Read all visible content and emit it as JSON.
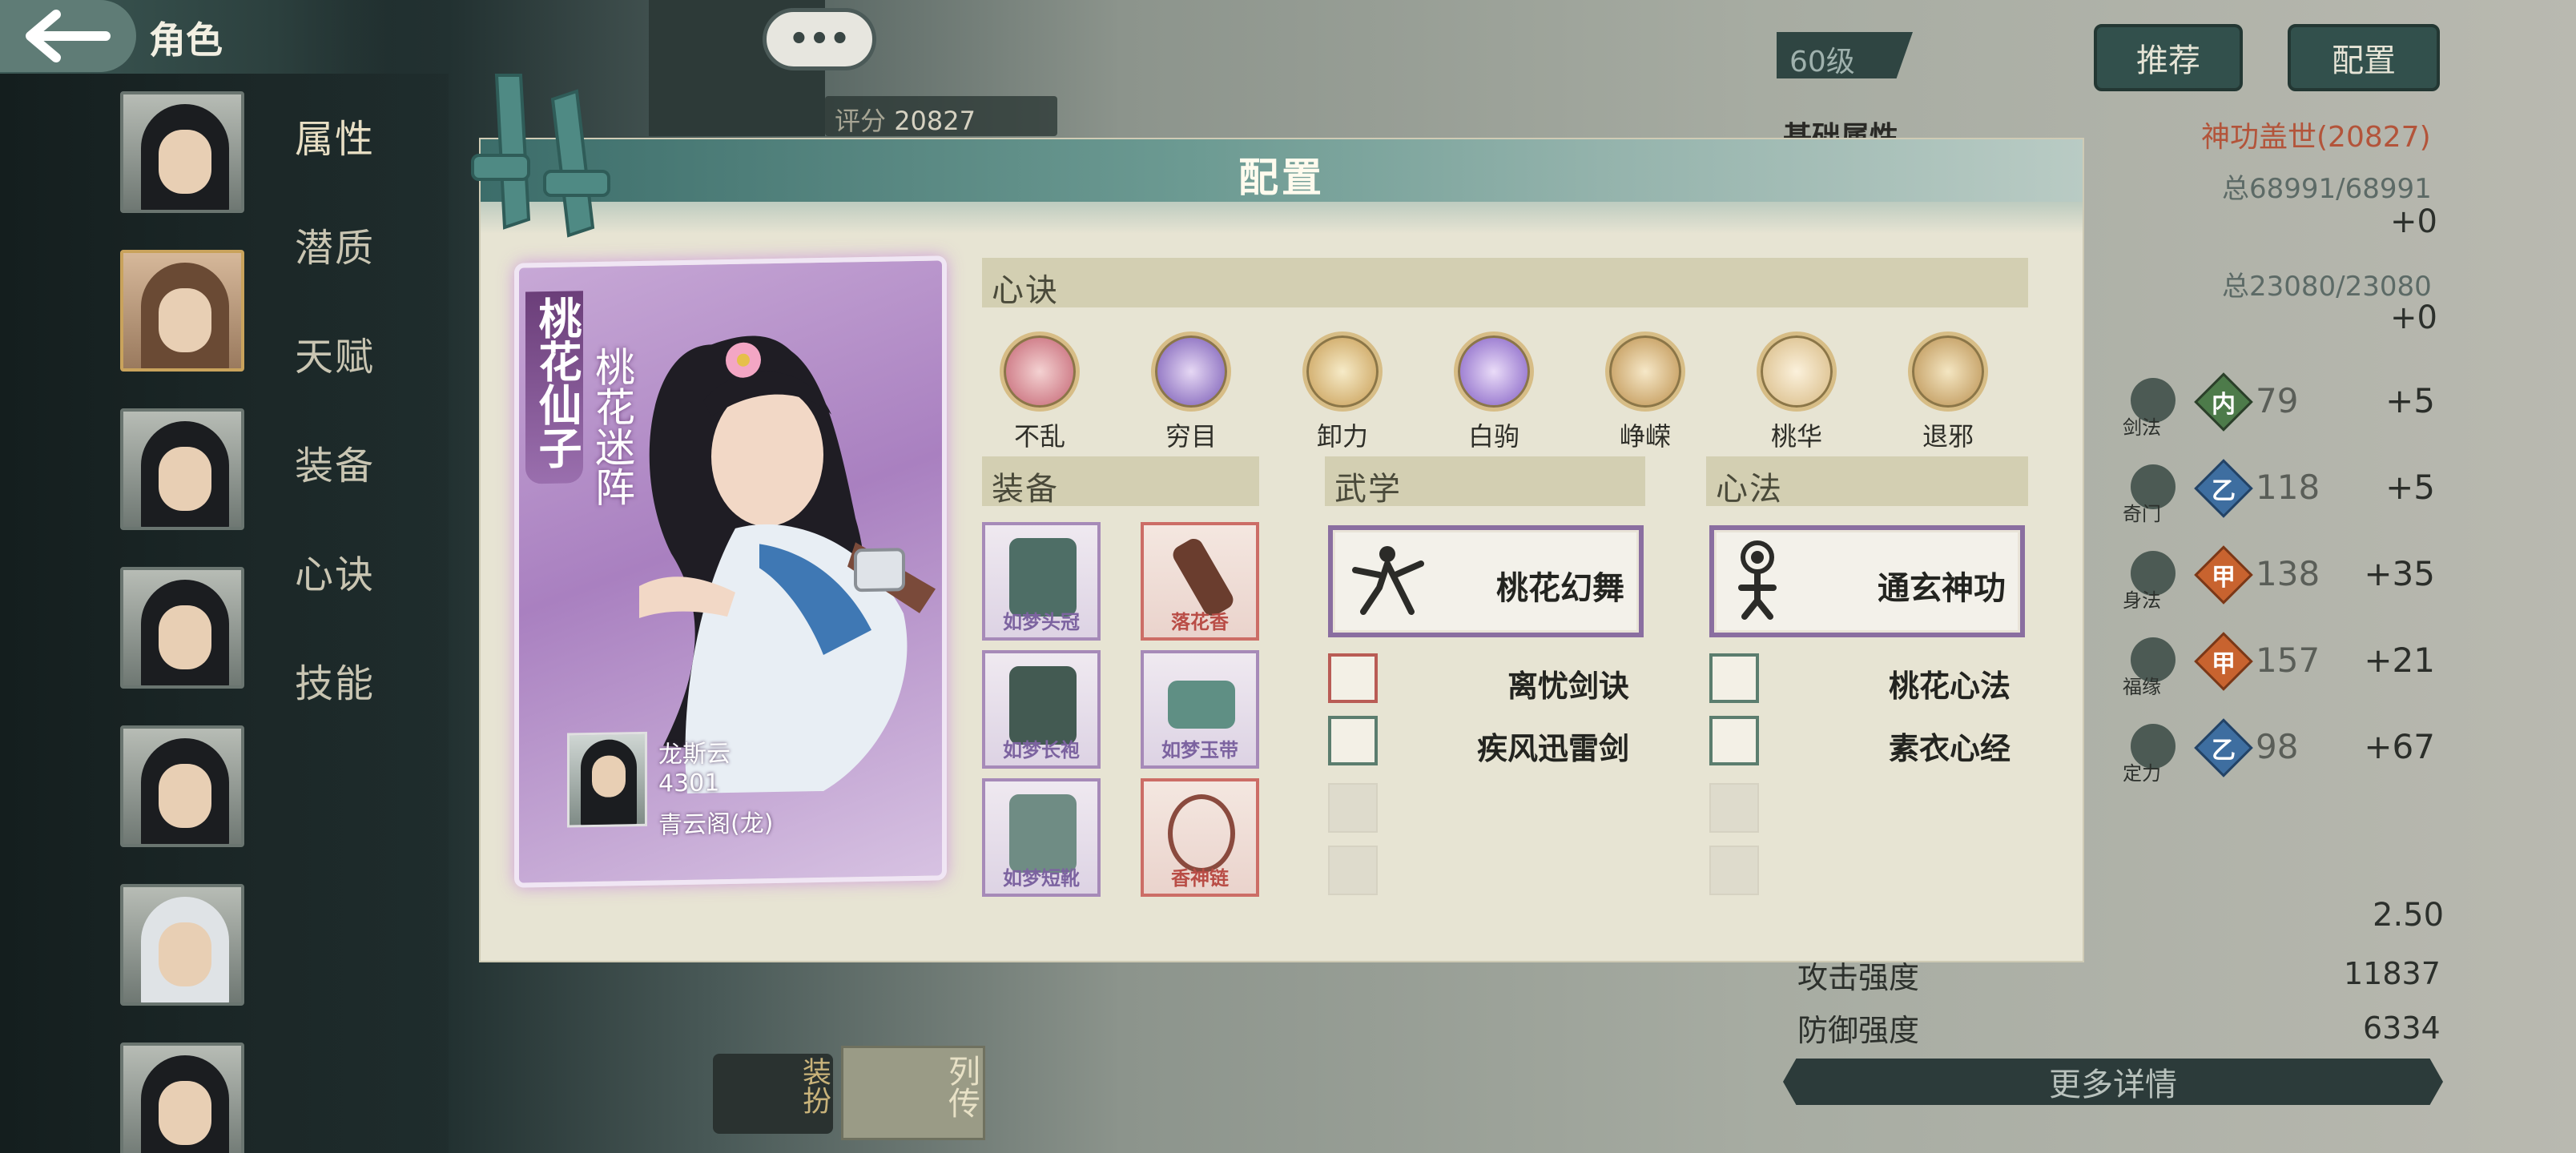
{
  "header": {
    "title": "角色"
  },
  "sidebar": {
    "nav": [
      "属性",
      "潜质",
      "天赋",
      "装备",
      "心诀",
      "技能"
    ]
  },
  "scene": {
    "chat_dots": "•••",
    "score_label": "评分",
    "score_value": "20827"
  },
  "right_panel": {
    "level": "60级",
    "recommend_label": "推荐",
    "config_label": "配置",
    "section_title": "基础属性",
    "rating": "神功盖世(20827)",
    "hp": "总68991/68991",
    "hp_bonus": "+0",
    "mp": "总23080/23080",
    "mp_bonus": "+0",
    "attrs": [
      {
        "cat": "剑法",
        "gem": "内",
        "value": "79",
        "bonus": "+5",
        "color": "green"
      },
      {
        "cat": "奇门",
        "gem": "乙",
        "value": "118",
        "bonus": "+5",
        "color": "blue"
      },
      {
        "cat": "身法",
        "gem": "甲",
        "value": "138",
        "bonus": "+35",
        "color": "orange"
      },
      {
        "cat": "福缘",
        "gem": "甲",
        "value": "157",
        "bonus": "+21",
        "color": "orange"
      },
      {
        "cat": "定力",
        "gem": "乙",
        "value": "98",
        "bonus": "+67",
        "color": "blue"
      }
    ],
    "crit_value": "2.50",
    "attack_label": "攻击强度",
    "attack_value": "11837",
    "defense_label": "防御强度",
    "defense_value": "6334",
    "more_label": "更多详情"
  },
  "bottom_tabs": {
    "equip_label": "装扮",
    "bio_label": "列传"
  },
  "modal": {
    "title": "配置",
    "character": {
      "title": "桃花仙子",
      "subtitle": "桃花迷阵",
      "owner_name": "龙斯云",
      "owner_id": "4301",
      "owner_guild": "青云阁(龙)"
    },
    "xinjue": {
      "label": "心诀",
      "skills": [
        {
          "name": "不乱",
          "color": "#d87a83"
        },
        {
          "name": "穷目",
          "color": "#7a5fb0"
        },
        {
          "name": "卸力",
          "color": "#c9a457"
        },
        {
          "name": "白驹",
          "color": "#8e6cc0"
        },
        {
          "name": "峥嵘",
          "color": "#caa05a"
        },
        {
          "name": "桃华",
          "color": "#dcc08a"
        },
        {
          "name": "退邪",
          "color": "#c9a35c"
        }
      ]
    },
    "equip": {
      "label": "装备",
      "items": [
        {
          "name": "如梦头冠",
          "rarity": "purple"
        },
        {
          "name": "落花香",
          "rarity": "red"
        },
        {
          "name": "如梦长袍",
          "rarity": "purple"
        },
        {
          "name": "如梦玉带",
          "rarity": "purple"
        },
        {
          "name": "如梦短靴",
          "rarity": "purple"
        },
        {
          "name": "香神链",
          "rarity": "red"
        }
      ]
    },
    "wuxue": {
      "label": "武学",
      "main": "桃花幻舞",
      "sub": [
        "离忧剑诀",
        "疾风迅雷剑"
      ]
    },
    "xinfa": {
      "label": "心法",
      "main": "通玄神功",
      "sub": [
        "桃花心法",
        "素衣心经"
      ]
    }
  }
}
